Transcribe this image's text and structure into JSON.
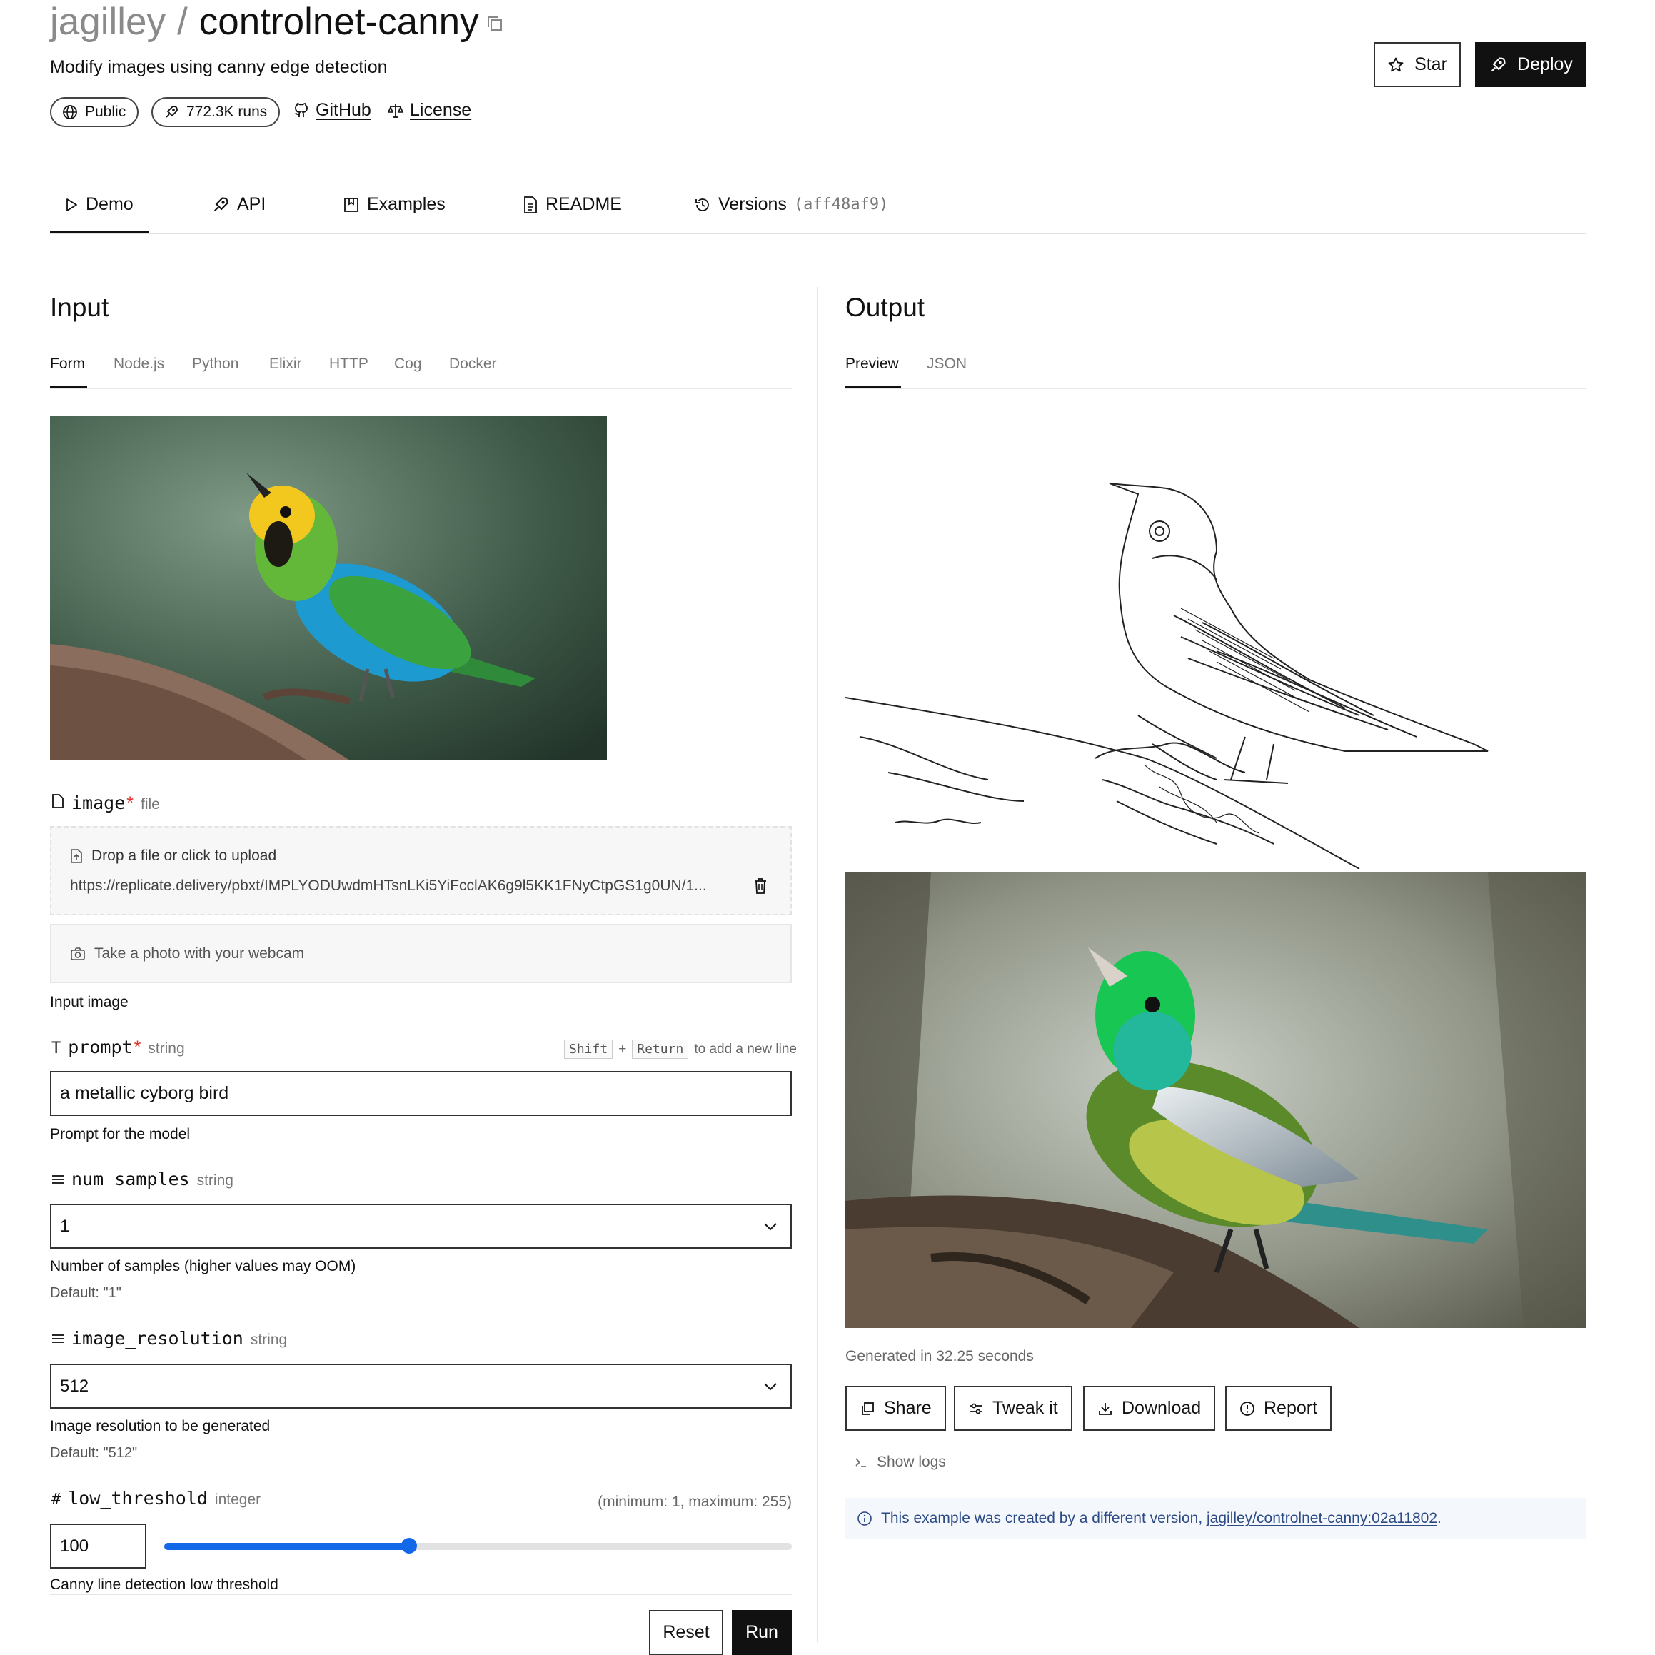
{
  "header": {
    "owner": "jagilley",
    "separator": "/",
    "model": "controlnet-canny",
    "description": "Modify images using canny edge detection",
    "visibility": "Public",
    "runs": "772.3K runs",
    "github": "GitHub",
    "license": "License",
    "star": "Star",
    "deploy": "Deploy"
  },
  "tabs": {
    "demo": "Demo",
    "api": "API",
    "examples": "Examples",
    "readme": "README",
    "versions": "Versions",
    "version_hash": "(aff48af9)"
  },
  "input": {
    "title": "Input",
    "subtabs": [
      "Form",
      "Node.js",
      "Python",
      "Elixir",
      "HTTP",
      "Cog",
      "Docker"
    ],
    "image": {
      "name": "image",
      "required": "*",
      "type": "file",
      "drop_text": "Drop a file or click to upload",
      "url": "https://replicate.delivery/pbxt/IMPLYODUwdmHTsnLKi5YiFcclAK6g9l5KK1FNyCtpGS1g0UN/1...",
      "webcam_text": "Take a photo with your webcam",
      "help": "Input image"
    },
    "prompt": {
      "name": "prompt",
      "required": "*",
      "type": "string",
      "kbd_shift": "Shift",
      "kbd_plus": "+",
      "kbd_return": "Return",
      "hint": "to add a new line",
      "value": "a metallic cyborg bird",
      "help": "Prompt for the model"
    },
    "num_samples": {
      "name": "num_samples",
      "type": "string",
      "value": "1",
      "help": "Number of samples (higher values may OOM)",
      "default": "Default: \"1\""
    },
    "image_resolution": {
      "name": "image_resolution",
      "type": "string",
      "value": "512",
      "help": "Image resolution to be generated",
      "default": "Default: \"512\""
    },
    "low_threshold": {
      "name": "low_threshold",
      "type": "integer",
      "range": "(minimum: 1, maximum: 255)",
      "value": "100",
      "slider_fraction": 0.39,
      "help": "Canny line detection low threshold"
    },
    "reset": "Reset",
    "run": "Run"
  },
  "output": {
    "title": "Output",
    "subtabs": [
      "Preview",
      "JSON"
    ],
    "generated": "Generated in 32.25 seconds",
    "share": "Share",
    "tweak": "Tweak it",
    "download": "Download",
    "report": "Report",
    "show_logs": "Show logs",
    "info_text": "This example was created by a different version,",
    "info_link": "jagilley/controlnet-canny:02a11802",
    "info_end": "."
  },
  "colors": {
    "accent_slider": "#1368e8",
    "required": "#e0322b",
    "info_text": "#2b4a86"
  }
}
